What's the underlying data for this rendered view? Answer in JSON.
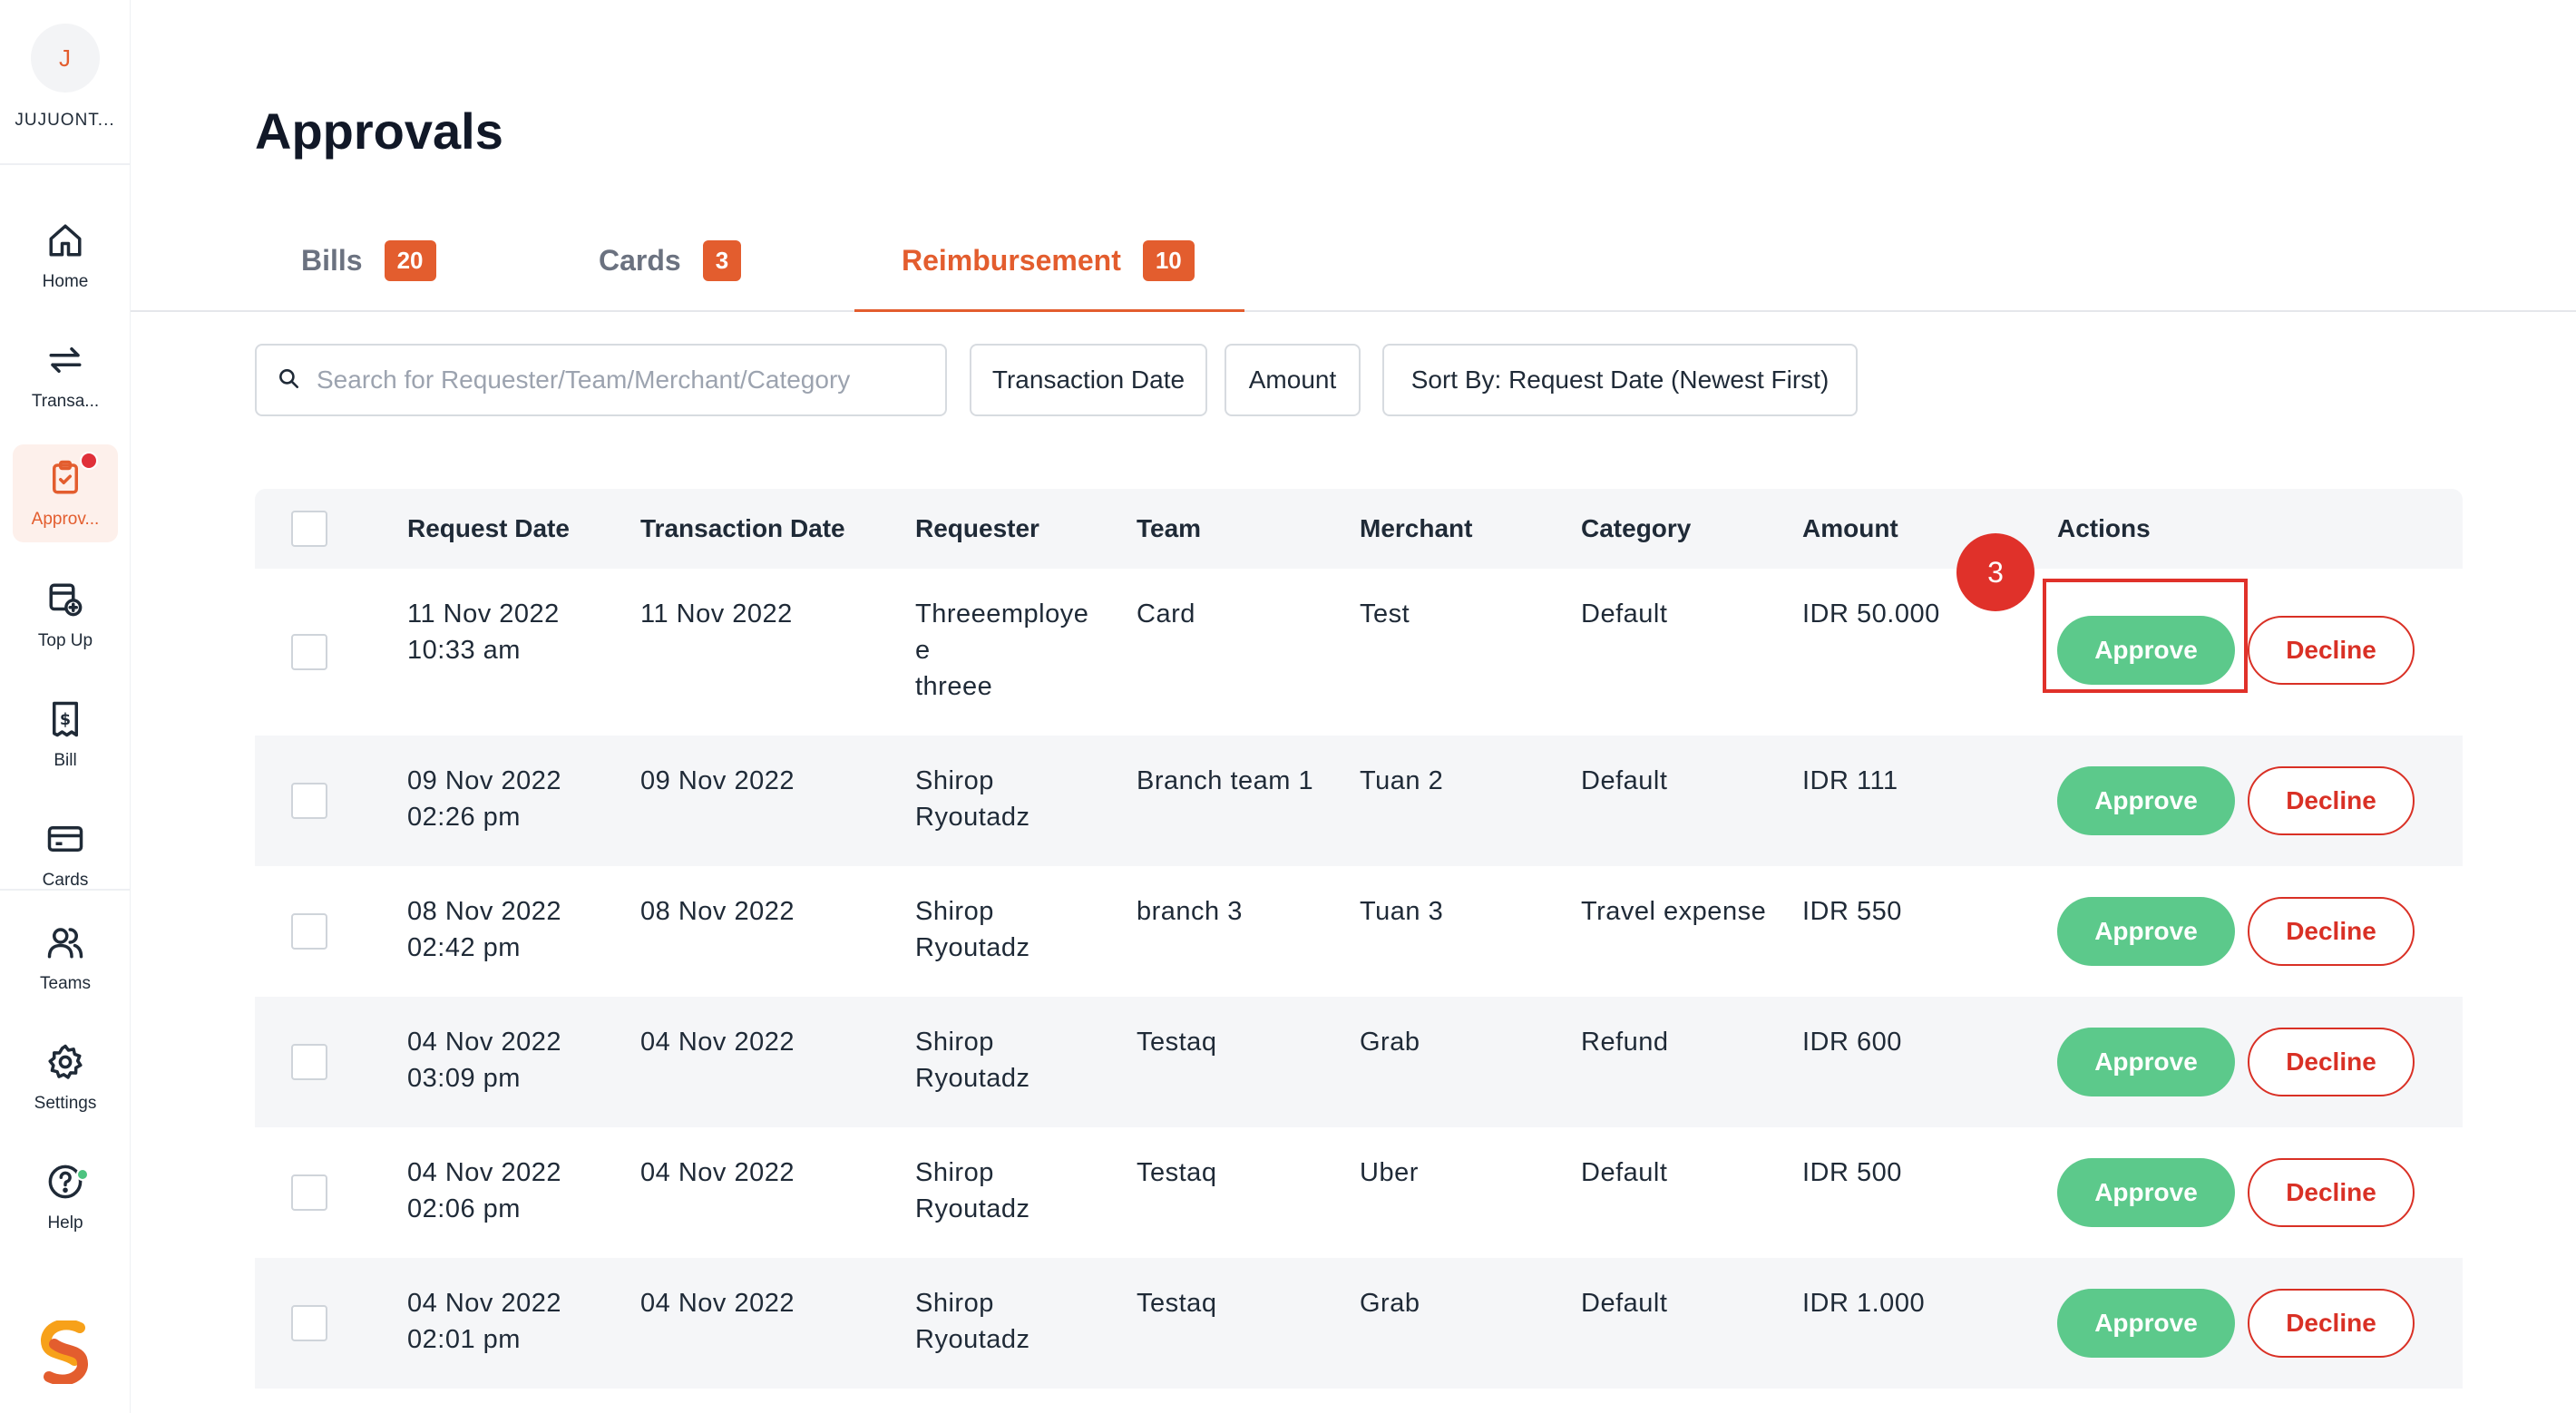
{
  "account": {
    "initial": "J",
    "name": "JUJUONT..."
  },
  "sidebar": {
    "items": [
      {
        "label": "Home",
        "icon": "home-icon"
      },
      {
        "label": "Transa...",
        "icon": "transfer-arrows-icon"
      },
      {
        "label": "Approv...",
        "icon": "approval-clipboard-icon"
      },
      {
        "label": "Top Up",
        "icon": "top-up-wallet-icon"
      },
      {
        "label": "Bill",
        "icon": "bill-dollar-icon"
      },
      {
        "label": "Cards",
        "icon": "credit-card-icon"
      },
      {
        "label": "Teams",
        "icon": "teams-people-icon"
      },
      {
        "label": "Settings",
        "icon": "gear-icon"
      },
      {
        "label": "Help",
        "icon": "help-question-icon"
      }
    ]
  },
  "page": {
    "title": "Approvals"
  },
  "tabs": [
    {
      "label": "Bills",
      "count": "20"
    },
    {
      "label": "Cards",
      "count": "3"
    },
    {
      "label": "Reimbursement",
      "count": "10"
    }
  ],
  "filters": {
    "search_placeholder": "Search for Requester/Team/Merchant/Category",
    "transaction_date": "Transaction Date",
    "amount": "Amount",
    "sort": "Sort By: Request Date (Newest First)"
  },
  "table": {
    "headers": [
      "Request Date",
      "Transaction Date",
      "Requester",
      "Team",
      "Merchant",
      "Category",
      "Amount",
      "Actions"
    ],
    "rows": [
      {
        "request_date": "11 Nov 2022",
        "request_time": "10:33 am",
        "transaction_date": "11 Nov 2022",
        "requester": [
          "Threeemploye",
          "e",
          "threee"
        ],
        "team": "Card",
        "merchant": "Test",
        "category": "Default",
        "amount": "IDR 50.000"
      },
      {
        "request_date": "09 Nov 2022",
        "request_time": "02:26 pm",
        "transaction_date": "09 Nov 2022",
        "requester": [
          "Shirop",
          "Ryoutadz"
        ],
        "team": "Branch team 1",
        "merchant": "Tuan 2",
        "category": "Default",
        "amount": "IDR 111"
      },
      {
        "request_date": "08 Nov 2022",
        "request_time": "02:42 pm",
        "transaction_date": "08 Nov 2022",
        "requester": [
          "Shirop",
          "Ryoutadz"
        ],
        "team": "branch 3",
        "merchant": "Tuan 3",
        "category": "Travel expense",
        "amount": "IDR 550"
      },
      {
        "request_date": "04 Nov 2022",
        "request_time": "03:09 pm",
        "transaction_date": "04 Nov 2022",
        "requester": [
          "Shirop",
          "Ryoutadz"
        ],
        "team": "Testaq",
        "merchant": "Grab",
        "category": "Refund",
        "amount": "IDR 600"
      },
      {
        "request_date": "04 Nov 2022",
        "request_time": "02:06 pm",
        "transaction_date": "04 Nov 2022",
        "requester": [
          "Shirop",
          "Ryoutadz"
        ],
        "team": "Testaq",
        "merchant": "Uber",
        "category": "Default",
        "amount": "IDR 500"
      },
      {
        "request_date": "04 Nov 2022",
        "request_time": "02:01 pm",
        "transaction_date": "04 Nov 2022",
        "requester": [
          "Shirop",
          "Ryoutadz"
        ],
        "team": "Testaq",
        "merchant": "Grab",
        "category": "Default",
        "amount": "IDR 1.000"
      }
    ],
    "approve_label": "Approve",
    "decline_label": "Decline"
  },
  "annotation": {
    "step": "3"
  },
  "colors": {
    "accent": "#e35d2e",
    "approve": "#5cc98b",
    "decline": "#d93025",
    "highlight": "#e0312a"
  }
}
